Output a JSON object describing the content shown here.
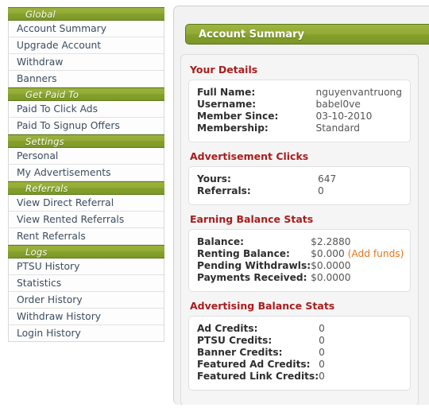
{
  "sidebar": {
    "groups": [
      {
        "header": "Global",
        "items": [
          "Account Summary",
          "Upgrade Account",
          "Withdraw",
          "Banners"
        ]
      },
      {
        "header": "Get Paid To",
        "items": [
          "Paid To Click Ads",
          "Paid To Signup Offers"
        ]
      },
      {
        "header": "Settings",
        "items": [
          "Personal",
          "My Advertisements"
        ]
      },
      {
        "header": "Referrals",
        "items": [
          "View Direct Referral",
          "View Rented Referrals",
          "Rent Referrals"
        ]
      },
      {
        "header": "Logs",
        "items": [
          "PTSU History",
          "Statistics",
          "Order History",
          "Withdraw History",
          "Login History"
        ]
      }
    ]
  },
  "main": {
    "page_title": "Account Summary",
    "sections": [
      {
        "title": "Your Details",
        "rows": [
          {
            "label": "Full Name:",
            "value": "nguyenvantruong"
          },
          {
            "label": "Username:",
            "value": "babel0ve"
          },
          {
            "label": "Member Since:",
            "value": "03-10-2010"
          },
          {
            "label": "Membership:",
            "value": "Standard"
          }
        ]
      },
      {
        "title": "Advertisement Clicks",
        "rows": [
          {
            "label": "Yours:",
            "value": "647"
          },
          {
            "label": "Referrals:",
            "value": "0"
          }
        ]
      },
      {
        "title": "Earning Balance Stats",
        "rows": [
          {
            "label": "Balance:",
            "value": "$2.2880"
          },
          {
            "label": "Renting Balance:",
            "value": "$0.000",
            "link": "(Add funds)"
          },
          {
            "label": "Pending Withdrawls:",
            "value": "$0.0000"
          },
          {
            "label": "Payments Received:",
            "value": "$0.0000"
          }
        ]
      },
      {
        "title": "Advertising Balance Stats",
        "rows": [
          {
            "label": "Ad Credits:",
            "value": "0"
          },
          {
            "label": "PTSU Credits:",
            "value": "0"
          },
          {
            "label": "Banner Credits:",
            "value": "0"
          },
          {
            "label": "Featured Ad Credits:",
            "value": "0"
          },
          {
            "label": "Featured Link Credits:",
            "value": "0"
          }
        ]
      }
    ]
  },
  "colors": {
    "nav_green_top": "#9bb23d",
    "nav_green_bottom": "#7d9827",
    "nav_border": "#5d7a1c",
    "section_heading_red": "#a81d1d",
    "link_orange": "#e8751a",
    "nav_link_text": "#3c4d60",
    "panel_bg": "#f2f2f2"
  }
}
